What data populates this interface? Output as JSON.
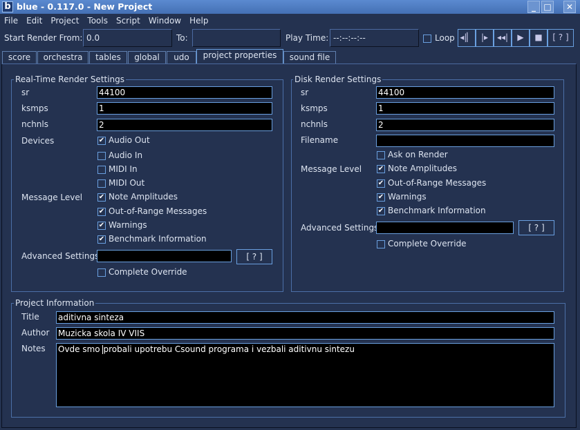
{
  "window": {
    "title": "blue - 0.117.0 - New Project",
    "logo": "b",
    "minimize": "_",
    "maximize": "□",
    "close": "✕"
  },
  "menu": [
    "File",
    "Edit",
    "Project",
    "Tools",
    "Script",
    "Window",
    "Help"
  ],
  "toolbar": {
    "start_label": "Start Render From:",
    "start_value": "0.0",
    "to_label": "To:",
    "to_value": "",
    "play_time_label": "Play Time:",
    "play_time_value": "--:--:--:--",
    "loop_label": "Loop",
    "loop_checked": false,
    "buttons": [
      "◂|▏",
      "|▸",
      "◂◂|",
      "▶",
      "■",
      "[ ? ]"
    ]
  },
  "tabs": [
    "score",
    "orchestra",
    "tables",
    "global",
    "udo",
    "project properties",
    "sound file"
  ],
  "active_tab": "project properties",
  "realtime": {
    "legend": "Real-Time Render Settings",
    "sr_label": "sr",
    "sr": "44100",
    "ksmps_label": "ksmps",
    "ksmps": "1",
    "nchnls_label": "nchnls",
    "nchnls": "2",
    "devices_label": "Devices",
    "devices": [
      {
        "label": "Audio Out",
        "checked": true
      },
      {
        "label": "Audio In",
        "checked": false
      },
      {
        "label": "MIDI In",
        "checked": false
      },
      {
        "label": "MIDI Out",
        "checked": false
      }
    ],
    "message_level_label": "Message Level",
    "messages": [
      {
        "label": "Note Amplitudes",
        "checked": true
      },
      {
        "label": "Out-of-Range Messages",
        "checked": true
      },
      {
        "label": "Warnings",
        "checked": true
      },
      {
        "label": "Benchmark Information",
        "checked": true
      }
    ],
    "advanced_label": "Advanced Settings",
    "advanced_value": "",
    "help": "[ ? ]",
    "override_label": "Complete Override",
    "override_checked": false
  },
  "disk": {
    "legend": "Disk Render Settings",
    "sr_label": "sr",
    "sr": "44100",
    "ksmps_label": "ksmps",
    "ksmps": "1",
    "nchnls_label": "nchnls",
    "nchnls": "2",
    "filename_label": "Filename",
    "filename": "",
    "ask_label": "Ask on Render",
    "ask_checked": false,
    "message_level_label": "Message Level",
    "messages": [
      {
        "label": "Note Amplitudes",
        "checked": true
      },
      {
        "label": "Out-of-Range Messages",
        "checked": true
      },
      {
        "label": "Warnings",
        "checked": true
      },
      {
        "label": "Benchmark Information",
        "checked": true
      }
    ],
    "advanced_label": "Advanced Settings",
    "advanced_value": "",
    "help": "[ ? ]",
    "override_label": "Complete Override",
    "override_checked": false
  },
  "project": {
    "legend": "Project Information",
    "title_label": "Title",
    "title": "aditivna sinteza",
    "author_label": "Author",
    "author": "Muzicka skola IV VIIS",
    "notes_label": "Notes",
    "notes_before": "Ovde smo ",
    "notes_after": "probali upotrebu Csound programa i vezbali aditivnu sintezu"
  }
}
